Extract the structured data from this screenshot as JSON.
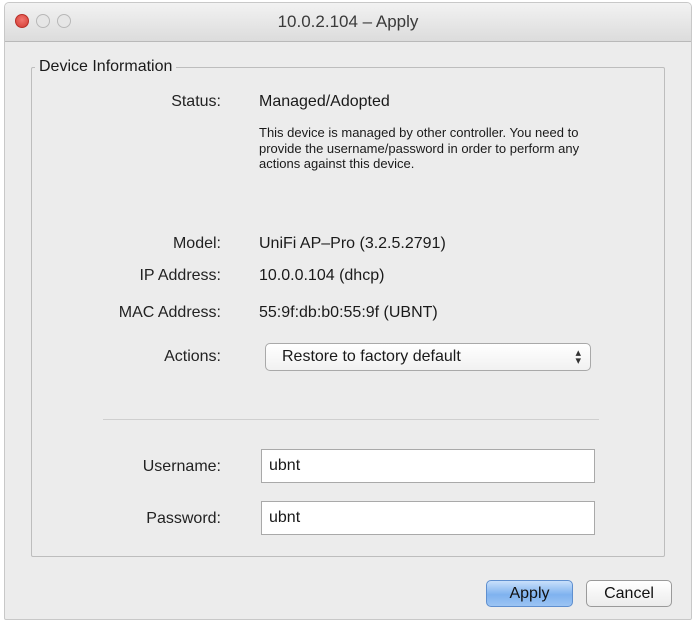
{
  "window": {
    "title": "10.0.2.104 – Apply"
  },
  "group": {
    "legend": "Device Information"
  },
  "fields": {
    "status_label": "Status:",
    "status_value": "Managed/Adopted",
    "status_note": "This device is managed by other controller. You need to provide the username/password in order to perform any actions against this device.",
    "model_label": "Model:",
    "model_value": "UniFi AP–Pro (3.2.5.2791)",
    "ip_label": "IP Address:",
    "ip_value": "10.0.0.104 (dhcp)",
    "mac_label": "MAC Address:",
    "mac_value": "55:9f:db:b0:55:9f (UBNT)",
    "actions_label": "Actions:",
    "actions_selected": "Restore to factory default",
    "username_label": "Username:",
    "username_value": "ubnt",
    "password_label": "Password:",
    "password_value": "ubnt"
  },
  "buttons": {
    "apply": "Apply",
    "cancel": "Cancel"
  },
  "icons": {
    "close": "close-icon",
    "minimize": "minimize-icon",
    "maximize": "maximize-icon",
    "select_arrows": "chevron-updown-icon"
  },
  "colors": {
    "close_button": "#d9463e",
    "apply_button": "#8dbbf2",
    "window_bg": "#ececec"
  }
}
